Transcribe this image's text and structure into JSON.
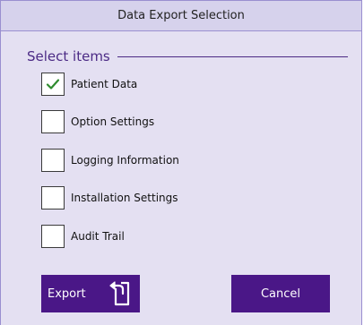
{
  "window": {
    "title": "Data Export Selection"
  },
  "group": {
    "title": "Select items"
  },
  "items": [
    {
      "label": "Patient Data",
      "checked": true
    },
    {
      "label": "Option Settings",
      "checked": false
    },
    {
      "label": "Logging Information",
      "checked": false
    },
    {
      "label": "Installation Settings",
      "checked": false
    },
    {
      "label": "Audit Trail",
      "checked": false
    }
  ],
  "buttons": {
    "export_label": "Export",
    "export_icon": "export-icon",
    "cancel_label": "Cancel"
  },
  "colors": {
    "background": "#e4e0f2",
    "titlebar": "#d6d2ec",
    "accent": "#4a1787",
    "checkmark": "#2e8b2e"
  }
}
